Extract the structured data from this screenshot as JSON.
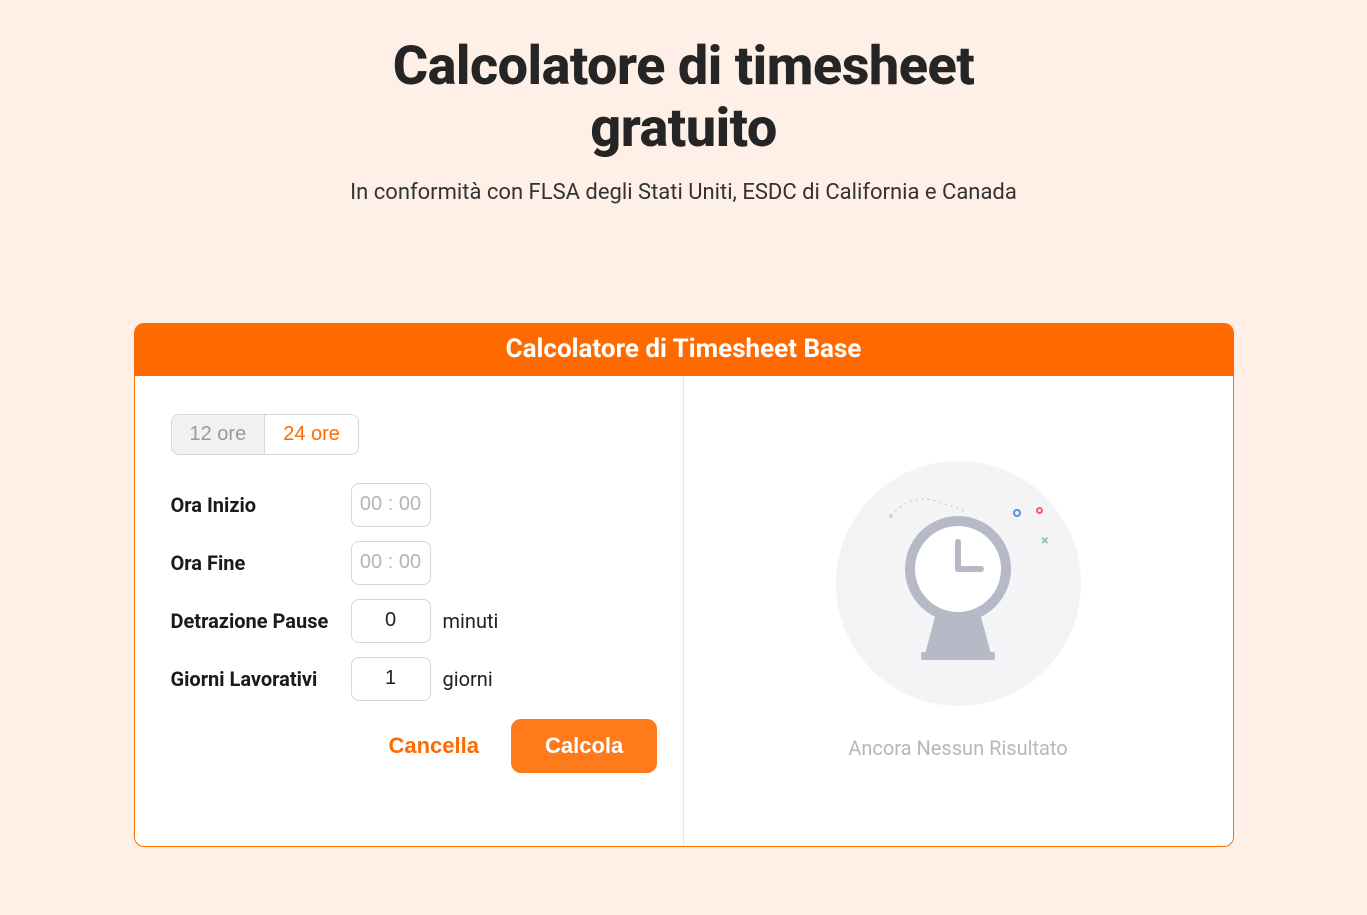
{
  "heading": {
    "title": "Calcolatore di timesheet gratuito",
    "subtitle": "In conformità con FLSA degli Stati Uniti, ESDC di California e Canada"
  },
  "card": {
    "title": "Calcolatore di Timesheet Base",
    "toggle": {
      "twelve": "12 ore",
      "twentyfour": "24 ore"
    },
    "rows": {
      "start": {
        "label": "Ora Inizio",
        "placeholder": "00 : 00"
      },
      "end": {
        "label": "Ora Fine",
        "placeholder": "00 : 00"
      },
      "break": {
        "label": "Detrazione Pause",
        "value": "0",
        "unit": "minuti"
      },
      "days": {
        "label": "Giorni Lavorativi",
        "value": "1",
        "unit": "giorni"
      }
    },
    "actions": {
      "cancel": "Cancella",
      "calculate": "Calcola"
    },
    "result": {
      "empty": "Ancora Nessun Risultato"
    }
  }
}
